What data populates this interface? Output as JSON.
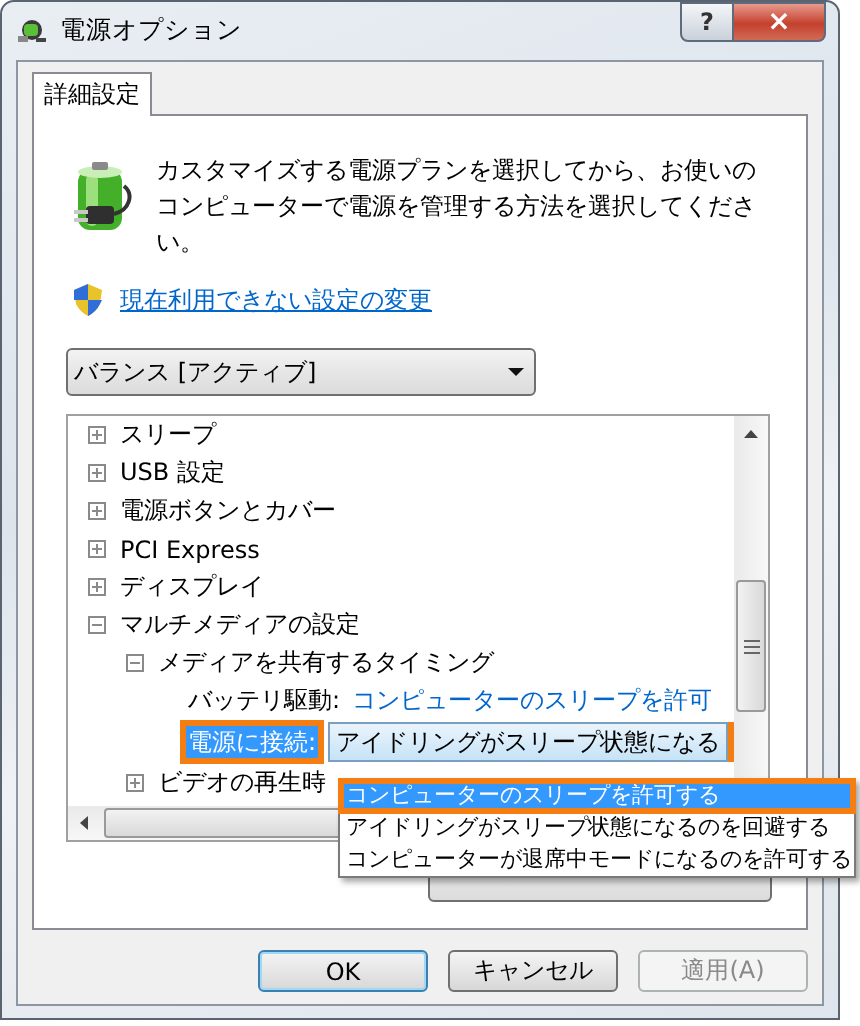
{
  "window": {
    "title": "電源オプション",
    "help": "?",
    "close": "×"
  },
  "tabs": [
    {
      "label": "詳細設定",
      "selected": true
    }
  ],
  "intro": "カスタマイズする電源プランを選択してから、お使いのコンピューターで電源を管理する方法を選択してください。",
  "admin_link": "現在利用できない設定の変更",
  "plan_select": {
    "value": "バランス [アクティブ]"
  },
  "settings_tree": [
    {
      "label": "スリープ",
      "expanded": false
    },
    {
      "label": "USB 設定",
      "expanded": false
    },
    {
      "label": "電源ボタンとカバー",
      "expanded": false
    },
    {
      "label": "PCI Express",
      "expanded": false
    },
    {
      "label": "ディスプレイ",
      "expanded": false
    },
    {
      "label": "マルチメディアの設定",
      "expanded": true,
      "children": [
        {
          "label": "メディアを共有するタイミング",
          "expanded": true,
          "children": [
            {
              "kind": "value",
              "label": "バッテリ駆動:",
              "value": "コンピューターのスリープを許可",
              "selected": false
            },
            {
              "kind": "select",
              "label": "電源に接続:",
              "value": "アイドリングがスリープ状態になる",
              "selected": true
            }
          ]
        },
        {
          "label": "ビデオの再生時",
          "expanded": false
        }
      ]
    }
  ],
  "dropdown_options": [
    {
      "label": "コンピューターのスリープを許可する",
      "selected": true
    },
    {
      "label": "アイドリングがスリープ状態になるのを回避する",
      "selected": false
    },
    {
      "label": "コンピューターが退席中モードになるのを許可する",
      "selected": false
    }
  ],
  "buttons": [
    {
      "label": "OK",
      "kind": "default",
      "disabled": false
    },
    {
      "label": "キャンセル",
      "kind": "normal",
      "disabled": false
    },
    {
      "label": "適用(A)",
      "kind": "normal",
      "disabled": true
    }
  ]
}
